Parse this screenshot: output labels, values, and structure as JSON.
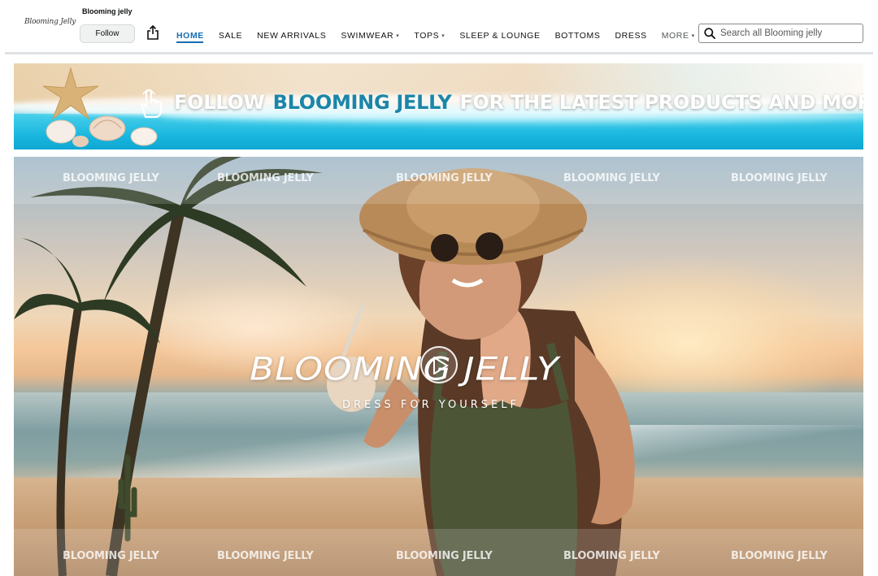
{
  "store": {
    "logo_text": "Blooming Jelly",
    "brand_name": "Blooming jelly",
    "follow_label": "Follow"
  },
  "nav": {
    "items": [
      {
        "label": "HOME",
        "active": true
      },
      {
        "label": "SALE"
      },
      {
        "label": "NEW ARRIVALS"
      },
      {
        "label": "SWIMWEAR",
        "dropdown": true
      },
      {
        "label": "TOPS",
        "dropdown": true
      },
      {
        "label": "SLEEP & LOUNGE"
      },
      {
        "label": "BOTTOMS"
      },
      {
        "label": "DRESS"
      },
      {
        "label": "MORE",
        "dropdown": true
      }
    ]
  },
  "search": {
    "placeholder": "Search all Blooming jelly",
    "icon": "search-icon"
  },
  "promo": {
    "part1": "FOLLOW",
    "highlight": "BLOOMING JELLY",
    "part2": "FOR THE LATEST PRODUCTS AND MORE!"
  },
  "hero": {
    "logo": "BLOOMING JELLY",
    "tagline": "DRESS FOR YOURSELF",
    "watermark": "BLOOMING JELLY"
  },
  "colors": {
    "accent": "#146eb4",
    "promo_highlight": "#1a86a8"
  }
}
